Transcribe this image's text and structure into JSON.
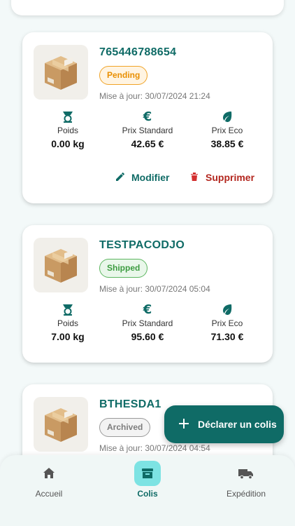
{
  "parcels": [
    {
      "id": "765446788654",
      "status": "Pending",
      "updated": "Mise à jour: 30/07/2024 21:24",
      "stats": {
        "weight_label": "Poids",
        "weight_value": "0.00 kg",
        "standard_label": "Prix Standard",
        "standard_value": "42.65 €",
        "eco_label": "Prix Eco",
        "eco_value": "38.85 €"
      },
      "actions": {
        "edit": "Modifier",
        "delete": "Supprimer"
      }
    },
    {
      "id": "TESTPACODJO",
      "status": "Shipped",
      "updated": "Mise à jour: 30/07/2024 05:04",
      "stats": {
        "weight_label": "Poids",
        "weight_value": "7.00 kg",
        "standard_label": "Prix Standard",
        "standard_value": "95.60 €",
        "eco_label": "Prix Eco",
        "eco_value": "71.30 €"
      }
    },
    {
      "id": "BTHESDA1",
      "status": "Archived",
      "updated": "Mise à jour: 30/07/2024 04:54"
    }
  ],
  "fab": {
    "label": "Déclarer un colis",
    "icon": "plus-icon"
  },
  "nav": [
    {
      "label": "Accueil",
      "icon": "home-icon",
      "active": false
    },
    {
      "label": "Colis",
      "icon": "archive-box-icon",
      "active": true
    },
    {
      "label": "Expédition",
      "icon": "truck-icon",
      "active": false
    }
  ],
  "colors": {
    "primary": "#0f6b66",
    "pending": "#e98f00",
    "shipped": "#3c9c40",
    "archived": "#7d7d7d",
    "delete": "#b3261e",
    "nav_active": "#7de3e3"
  }
}
